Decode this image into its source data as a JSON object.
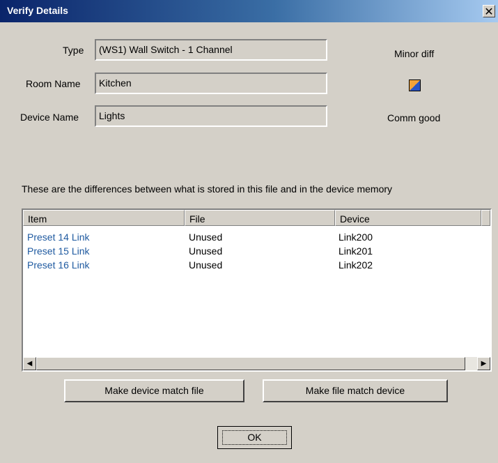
{
  "window": {
    "title": "Verify Details",
    "close_symbol": "✕"
  },
  "fields": {
    "type_label": "Type",
    "type_value": "(WS1) Wall Switch - 1 Channel",
    "room_label": "Room Name",
    "room_value": "Kitchen",
    "device_label": "Device Name",
    "device_value": "Lights"
  },
  "status": {
    "diff_text": "Minor diff",
    "comm_text": "Comm good",
    "icon": "status-square-icon",
    "colors": {
      "orange": "#f4a33a",
      "blue": "#2a55c8"
    }
  },
  "description": "These are the differences between what is stored in this file and in the device memory",
  "table": {
    "columns": [
      "Item",
      "File",
      "Device"
    ],
    "rows": [
      {
        "item": "Preset 14 Link",
        "file": "Unused",
        "device": "Link200"
      },
      {
        "item": "Preset 15 Link",
        "file": "Unused",
        "device": "Link201"
      },
      {
        "item": "Preset 16 Link",
        "file": "Unused",
        "device": "Link202"
      }
    ]
  },
  "buttons": {
    "match_file": "Make device match file",
    "match_device": "Make file match device",
    "ok": "OK"
  },
  "colors": {
    "title_start": "#0a246a",
    "title_end": "#a6caf0",
    "link_text": "#1f5aa0",
    "window_bg": "#d4d0c8"
  }
}
